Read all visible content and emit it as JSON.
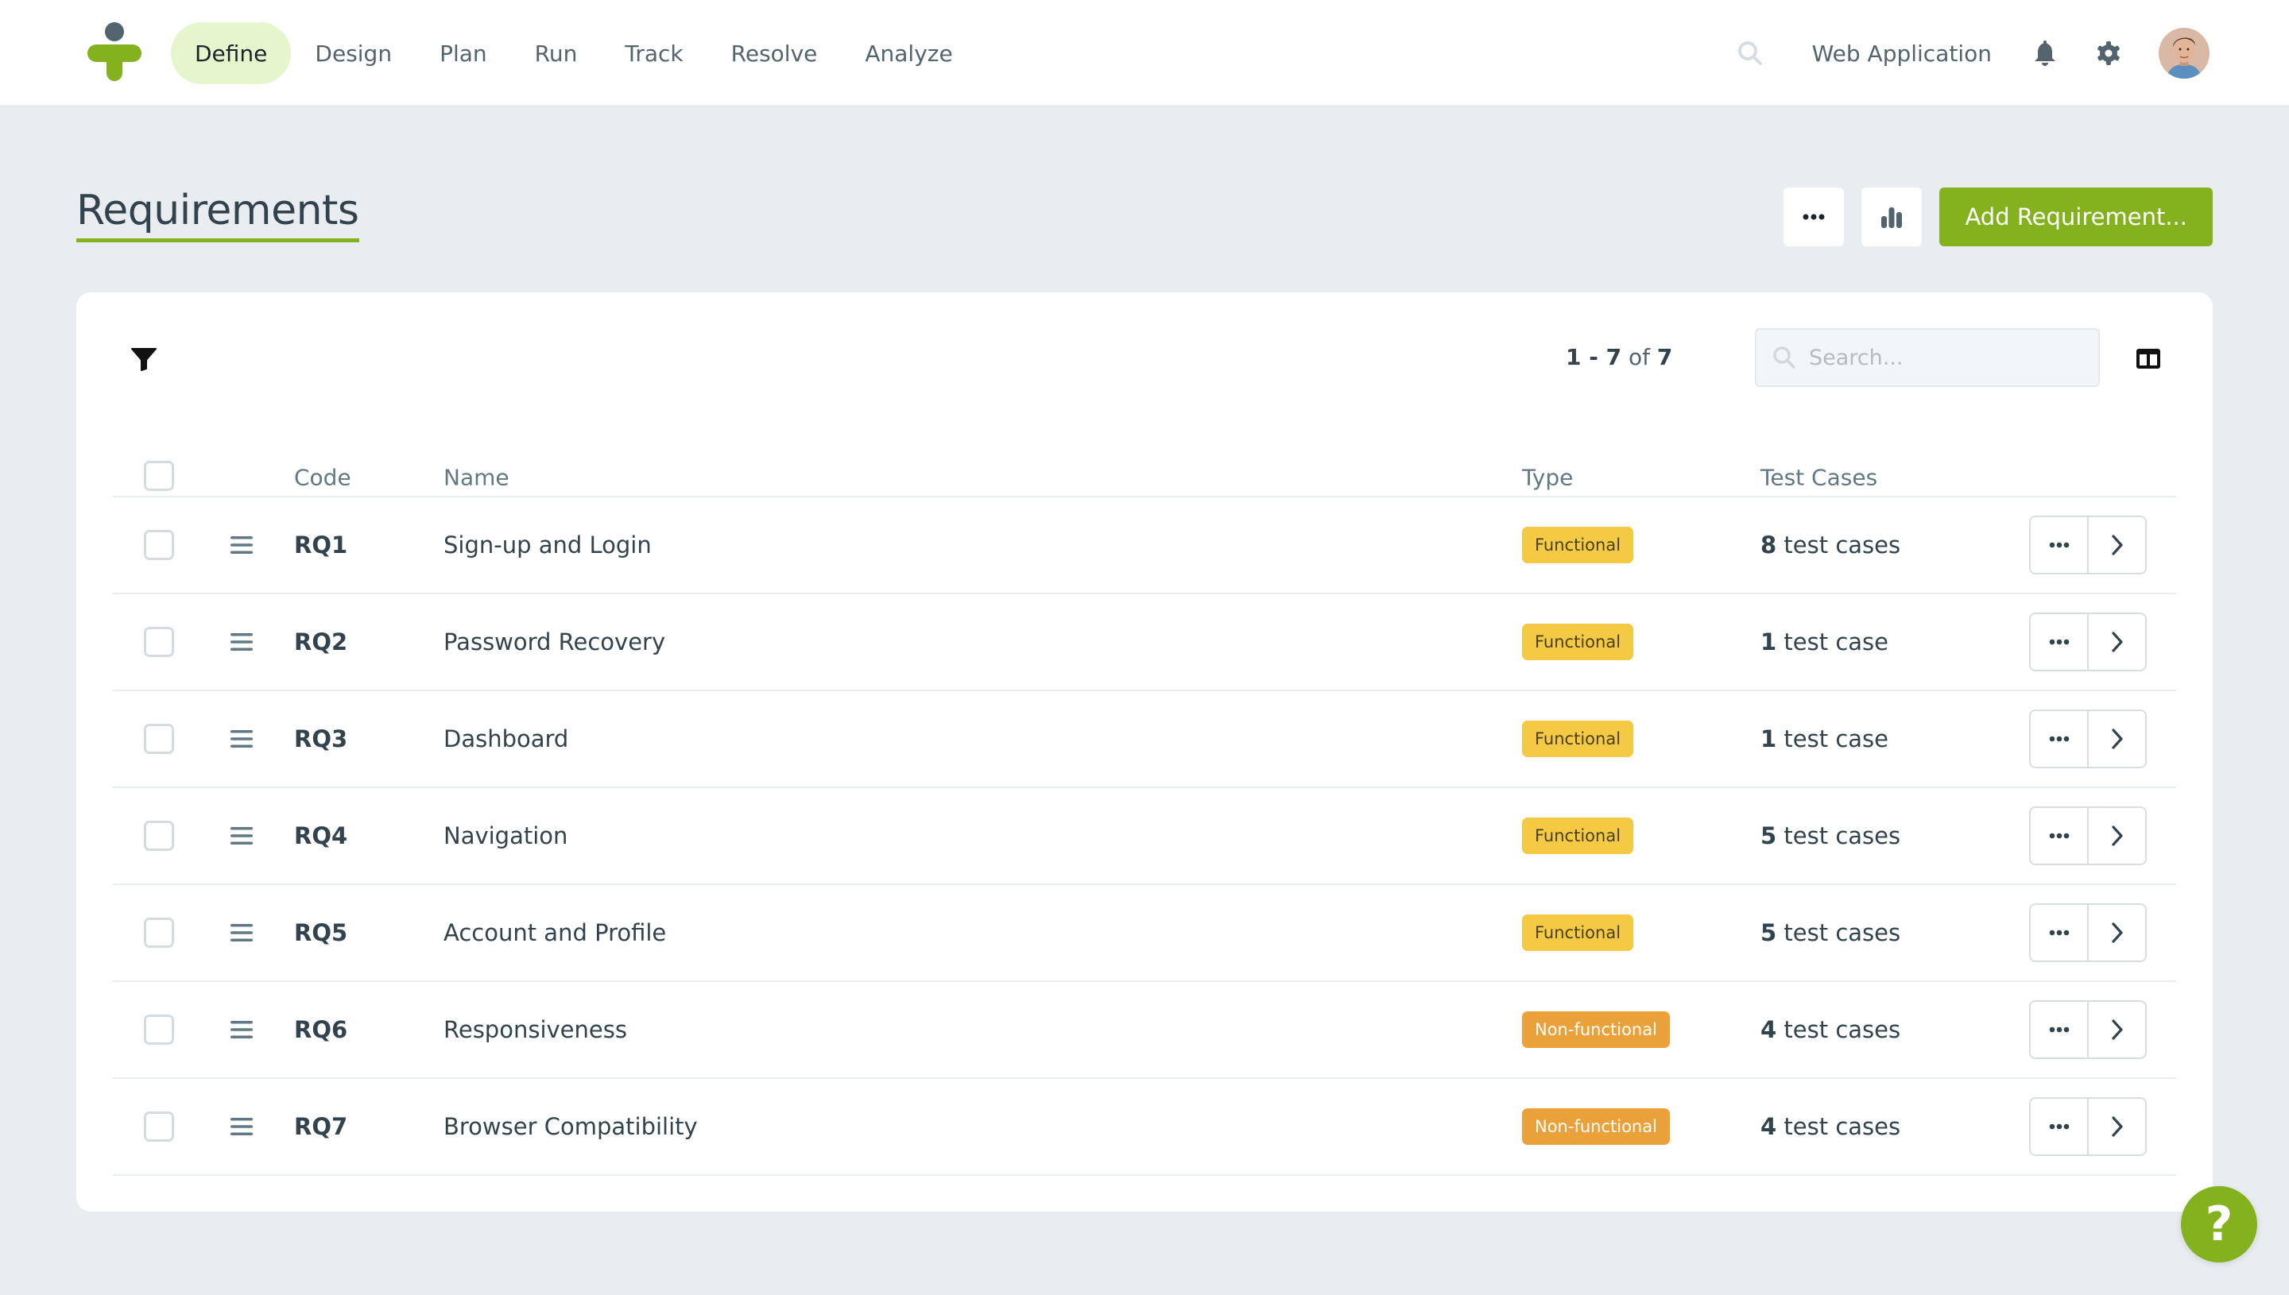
{
  "nav": {
    "items": [
      {
        "label": "Define",
        "active": true
      },
      {
        "label": "Design",
        "active": false
      },
      {
        "label": "Plan",
        "active": false
      },
      {
        "label": "Run",
        "active": false
      },
      {
        "label": "Track",
        "active": false
      },
      {
        "label": "Resolve",
        "active": false
      },
      {
        "label": "Analyze",
        "active": false
      }
    ],
    "project_name": "Web Application",
    "icons": {
      "search": "search-icon",
      "notifications": "bell-icon",
      "settings": "gear-icon",
      "avatar": "user-avatar"
    }
  },
  "page": {
    "title": "Requirements",
    "more_icon": "ellipsis-icon",
    "chart_icon": "bar-chart-icon",
    "add_button_label": "Add Requirement..."
  },
  "toolbar": {
    "filter_icon": "filter-icon",
    "pagination": {
      "from": "1",
      "to": "7",
      "sep": " - ",
      "of_label": " of ",
      "total": "7"
    },
    "search_placeholder": "Search...",
    "search_value": "",
    "columns_icon": "columns-icon"
  },
  "table": {
    "headers": {
      "code": "Code",
      "name": "Name",
      "type": "Type",
      "test_cases": "Test Cases"
    },
    "rows": [
      {
        "code": "RQ1",
        "name": "Sign-up and Login",
        "type": "Functional",
        "type_kind": "functional",
        "tc_count": "8",
        "tc_label": " test cases"
      },
      {
        "code": "RQ2",
        "name": "Password Recovery",
        "type": "Functional",
        "type_kind": "functional",
        "tc_count": "1",
        "tc_label": " test case"
      },
      {
        "code": "RQ3",
        "name": "Dashboard",
        "type": "Functional",
        "type_kind": "functional",
        "tc_count": "1",
        "tc_label": " test case"
      },
      {
        "code": "RQ4",
        "name": "Navigation",
        "type": "Functional",
        "type_kind": "functional",
        "tc_count": "5",
        "tc_label": " test cases"
      },
      {
        "code": "RQ5",
        "name": "Account and Profile",
        "type": "Functional",
        "type_kind": "functional",
        "tc_count": "5",
        "tc_label": " test cases"
      },
      {
        "code": "RQ6",
        "name": "Responsiveness",
        "type": "Non-functional",
        "type_kind": "nonfunctional",
        "tc_count": "4",
        "tc_label": " test cases"
      },
      {
        "code": "RQ7",
        "name": "Browser Compatibility",
        "type": "Non-functional",
        "type_kind": "nonfunctional",
        "tc_count": "4",
        "tc_label": " test cases"
      }
    ]
  },
  "help": {
    "label": "?"
  },
  "colors": {
    "brand_green": "#84b21e",
    "active_nav_bg": "#e6f6cc",
    "functional_badge": "#f4ca45",
    "nonfunctional_badge": "#eaa13a",
    "page_bg": "#e9edf0"
  }
}
